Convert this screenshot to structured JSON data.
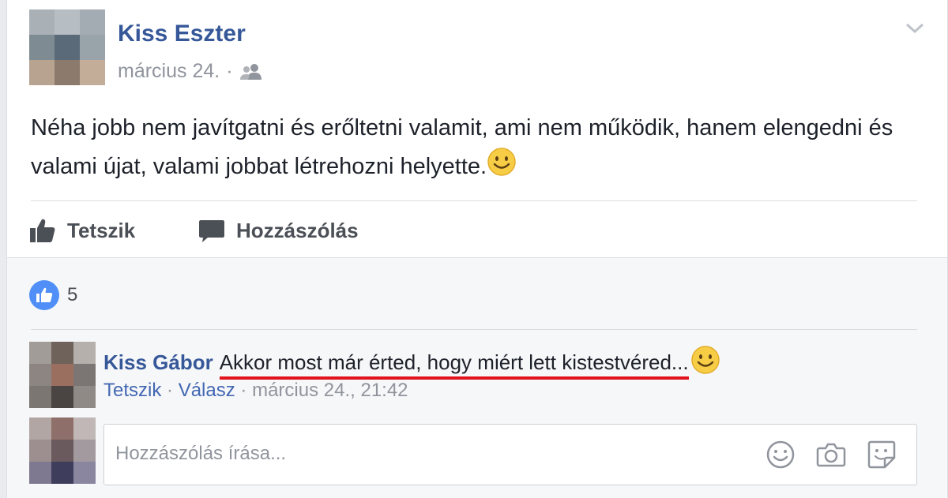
{
  "post": {
    "author": "Kiss Eszter",
    "date": "március 24.",
    "separator": "·",
    "audience_icon": "friends-icon",
    "text": "Néha jobb nem javítgatni és erőltetni valamit, ami nem működik, hanem elengedni és valami újat, valami jobbat létrehozni helyette."
  },
  "actions": {
    "like_label": "Tetszik",
    "comment_label": "Hozzászólás"
  },
  "reactions": {
    "count": "5",
    "icon": "like-icon",
    "color": "#4f8ff7"
  },
  "comment": {
    "author": "Kiss Gábor",
    "text": "Akkor most már érted, hogy miért lett kistestvéred...",
    "like_link": "Tetszik",
    "reply_link": "Válasz",
    "separator": "·",
    "timestamp": "március 24., 21:42",
    "highlight_color": "#e0141e"
  },
  "composer": {
    "placeholder": "Hozzászólás írása...",
    "icons": [
      "emoji-icon",
      "camera-icon",
      "sticker-icon"
    ]
  },
  "colors": {
    "link": "#365899",
    "muted": "#90949c",
    "background": "#e9ebee"
  }
}
